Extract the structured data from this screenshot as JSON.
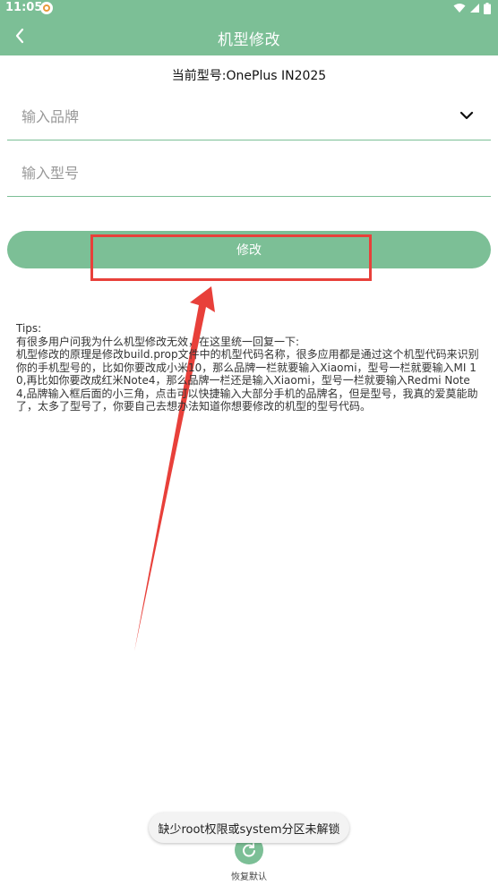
{
  "status_bar": {
    "time": "11:05",
    "icons": [
      "app-notification-icon",
      "wifi-icon",
      "signal-icon",
      "battery-icon"
    ]
  },
  "app_bar": {
    "title": "机型修改",
    "back_icon": "chevron-left-icon"
  },
  "current_model": "当前型号:OnePlus IN2025",
  "form": {
    "brand_placeholder": "输入品牌",
    "brand_value": "",
    "model_placeholder": "输入型号",
    "model_value": "",
    "dropdown_icon": "chevron-down-icon",
    "submit_label": "修改"
  },
  "tips": {
    "label": "Tips:",
    "body": "有很多用户问我为什么机型修改无效，在这里统一回复一下:\n机型修改的原理是修改build.prop文件中的机型代码名称，很多应用都是通过这个机型代码来识别你的手机型号的，比如你要改成小米10，那么品牌一栏就要输入Xiaomi，型号一栏就要输入MI 10,再比如你要改成红米Note4，那么品牌一栏还是输入Xiaomi，型号一栏就要输入Redmi Note 4,品牌输入框后面的小三角，点击可以快捷输入大部分手机的品牌名，但是型号，我真的爱莫能助了，太多了型号了，你要自己去想办法知道你想要修改的机型的型号代码。"
  },
  "restore": {
    "label": "恢复默认",
    "icon": "restore-icon"
  },
  "toast": {
    "message": "缺少root权限或system分区未解锁"
  },
  "colors": {
    "accent": "#7cbf96",
    "annotation_red": "#e8403a"
  }
}
